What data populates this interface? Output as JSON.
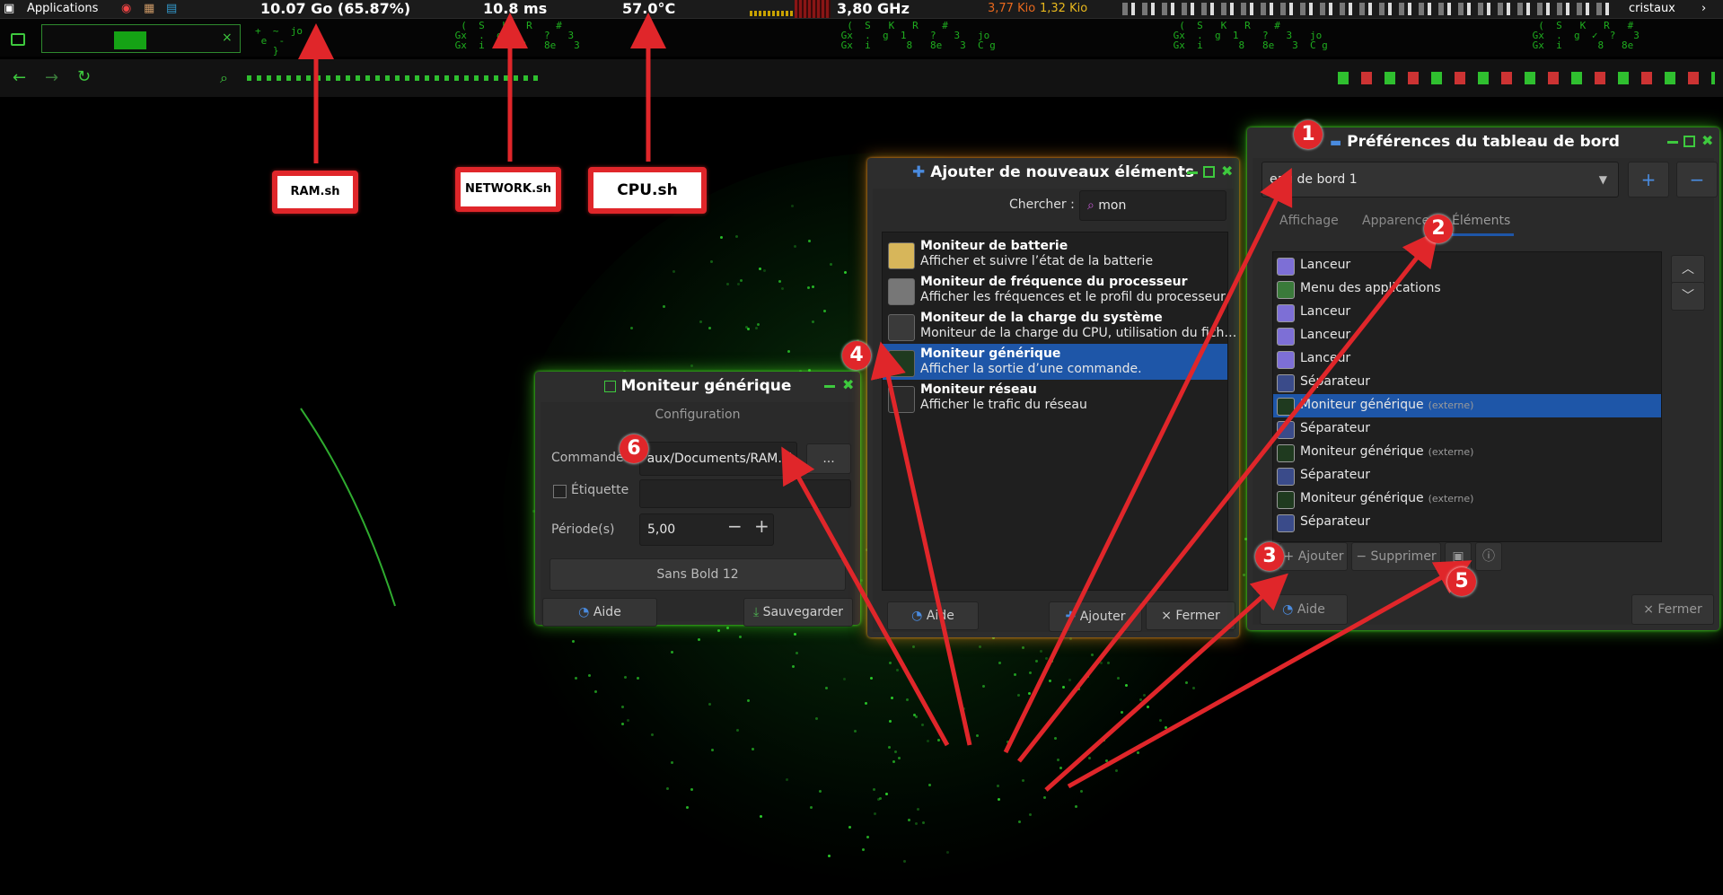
{
  "panel": {
    "apps_label": "Applications",
    "ram": "10.07 Go (65.87%)",
    "network": "10.8 ms",
    "cpu": "57.0°C",
    "freq": "3,80 GHz",
    "net_up": "3,77 Kio",
    "net_down": "1,32 Kio",
    "user": "cristaux"
  },
  "labels": {
    "ram": "RAM.sh",
    "network": "NETWORK.sh",
    "cpu": "CPU.sh"
  },
  "generic_monitor": {
    "title": "Moniteur générique",
    "section": "Configuration",
    "command_label": "Commande",
    "command_value": "aux/Documents/RAM.sh",
    "browse_label": "...",
    "label_checkbox": "Étiquette",
    "period_label": "Période(s)",
    "period_value": "5,00",
    "font_button": "Sans Bold 12",
    "help_button": "Aide",
    "save_button": "Sauvegarder"
  },
  "add_items": {
    "title": "Ajouter de nouveaux éléments",
    "search_label": "Chercher :",
    "search_value": "mon",
    "items": [
      {
        "name": "Moniteur de batterie",
        "desc": "Afficher et suivre l’état de la batterie",
        "icon": "battery-icon"
      },
      {
        "name": "Moniteur de fréquence du processeur",
        "desc": "Afficher les fréquences et le profil du processeur",
        "icon": "cpufreq-icon"
      },
      {
        "name": "Moniteur de la charge du système",
        "desc": "Moniteur de la charge du CPU, utilisation du fich…",
        "icon": "sysload-icon"
      },
      {
        "name": "Moniteur générique",
        "desc": "Afficher la sortie d’une commande.",
        "icon": "genmon-icon"
      },
      {
        "name": "Moniteur réseau",
        "desc": "Afficher le trafic du réseau",
        "icon": "network-icon"
      }
    ],
    "help_button": "Aide",
    "add_button": "Ajouter",
    "close_button": "Fermer"
  },
  "prefs": {
    "title": "Préférences du tableau de bord",
    "panel_select": "eau de bord 1",
    "tabs": [
      "Affichage",
      "Apparence",
      "Éléments"
    ],
    "items": [
      {
        "label": "Lanceur",
        "ext": "",
        "icon": "launcher-icon"
      },
      {
        "label": "Menu des applications",
        "ext": "",
        "icon": "menu-icon"
      },
      {
        "label": "Lanceur",
        "ext": "",
        "icon": "launcher-icon"
      },
      {
        "label": "Lanceur",
        "ext": "",
        "icon": "launcher-icon"
      },
      {
        "label": "Lanceur",
        "ext": "",
        "icon": "launcher-icon"
      },
      {
        "label": "Séparateur",
        "ext": "",
        "icon": "separator-icon"
      },
      {
        "label": "Moniteur générique",
        "ext": "(externe)",
        "icon": "genmon-icon"
      },
      {
        "label": "Séparateur",
        "ext": "",
        "icon": "separator-icon"
      },
      {
        "label": "Moniteur générique",
        "ext": "(externe)",
        "icon": "genmon-icon"
      },
      {
        "label": "Séparateur",
        "ext": "",
        "icon": "separator-icon"
      },
      {
        "label": "Moniteur générique",
        "ext": "(externe)",
        "icon": "genmon-icon"
      },
      {
        "label": "Séparateur",
        "ext": "",
        "icon": "separator-icon"
      }
    ],
    "add_button": "Ajouter",
    "remove_button": "Supprimer",
    "help_button": "Aide",
    "close_button": "Fermer"
  },
  "badges": [
    "1",
    "2",
    "3",
    "4",
    "5",
    "6"
  ],
  "colors": {
    "accent": "#1e56a8",
    "glow": "#3ec93e",
    "callout": "#e0262a"
  }
}
